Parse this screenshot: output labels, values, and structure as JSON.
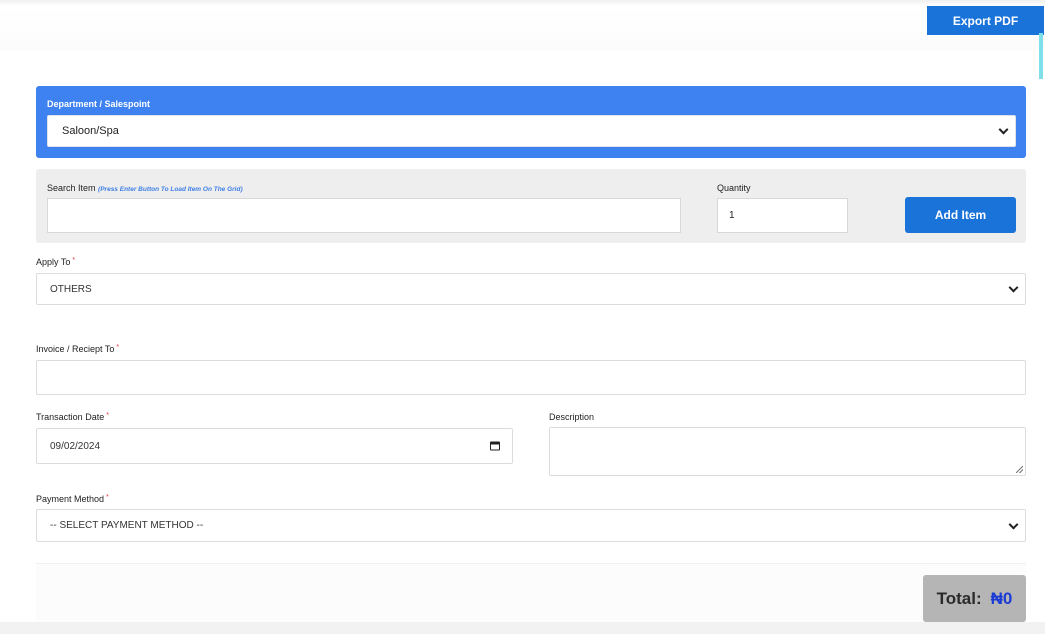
{
  "toolbar": {
    "export_label": "Export PDF"
  },
  "department": {
    "label": "Department / Salespoint",
    "selected": "Saloon/Spa"
  },
  "search": {
    "label": "Search Item",
    "hint": "(Press Enter Button To Load Item On The Grid)",
    "value": ""
  },
  "quantity": {
    "label": "Quantity",
    "value": "1"
  },
  "add_item": {
    "label": "Add Item"
  },
  "apply_to": {
    "label": "Apply To",
    "required_mark": "*",
    "selected": "OTHERS"
  },
  "invoice_to": {
    "label": "Invoice / Reciept To",
    "required_mark": "*",
    "value": ""
  },
  "transaction_date": {
    "label": "Transaction Date",
    "required_mark": "*",
    "value": "09/02/2024"
  },
  "description": {
    "label": "Description",
    "value": ""
  },
  "payment_method": {
    "label": "Payment Method",
    "required_mark": "*",
    "selected": "-- SELECT PAYMENT METHOD --"
  },
  "total": {
    "label": "Total:",
    "amount": "₦0"
  },
  "colors": {
    "primary_button": "#1a73d9",
    "department_panel": "#3d82f0",
    "required": "#e53935",
    "total_amount": "#1a3cd4"
  },
  "icons": [
    "chevron-down-icon",
    "calendar-icon",
    "resize-handle-icon"
  ]
}
